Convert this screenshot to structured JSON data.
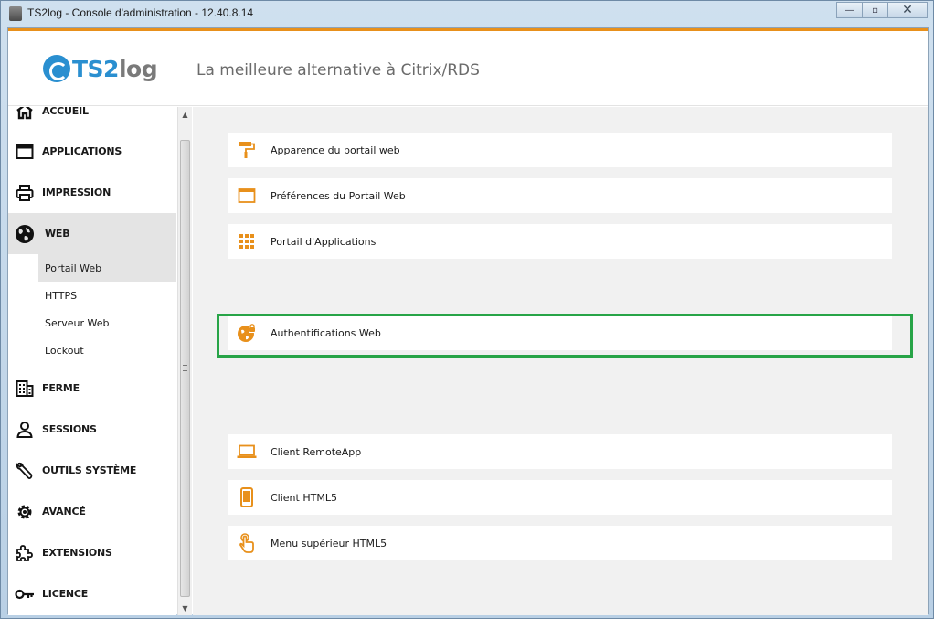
{
  "window": {
    "title": "TS2log - Console d'administration - 12.40.8.14",
    "minimize_glyph": "—",
    "maximize_glyph": "▫",
    "close_glyph": "✕"
  },
  "header": {
    "logo_ts": "TS2",
    "logo_log": "log",
    "tagline": "La meilleure alternative à Citrix/RDS"
  },
  "colors": {
    "accent": "#e8901b",
    "brand_blue": "#2a8fd0",
    "highlight": "#27a447"
  },
  "sidebar": {
    "items": [
      {
        "label": "ACCUEIL",
        "icon": "home-icon"
      },
      {
        "label": "APPLICATIONS",
        "icon": "window-icon"
      },
      {
        "label": "IMPRESSION",
        "icon": "printer-icon"
      },
      {
        "label": "WEB",
        "icon": "globe-icon",
        "active": true
      },
      {
        "label": "FERME",
        "icon": "building-icon"
      },
      {
        "label": "SESSIONS",
        "icon": "user-icon"
      },
      {
        "label": "OUTILS SYSTÈME",
        "icon": "wrench-icon"
      },
      {
        "label": "AVANCÉ",
        "icon": "gear-icon"
      },
      {
        "label": "EXTENSIONS",
        "icon": "puzzle-icon"
      },
      {
        "label": "LICENCE",
        "icon": "key-icon"
      }
    ],
    "web_subitems": [
      {
        "label": "Portail Web",
        "active": true
      },
      {
        "label": "HTTPS"
      },
      {
        "label": "Serveur Web"
      },
      {
        "label": "Lockout"
      }
    ]
  },
  "main": {
    "cards": [
      {
        "label": "Apparence du portail web",
        "icon": "paint-roller-icon"
      },
      {
        "label": "Préférences du Portail Web",
        "icon": "browser-window-icon"
      },
      {
        "label": "Portail d'Applications",
        "icon": "app-grid-icon"
      },
      {
        "label": "Authentifications Web",
        "icon": "globe-lock-icon",
        "highlighted": true
      },
      {
        "label": "Client RemoteApp",
        "icon": "laptop-icon"
      },
      {
        "label": "Client HTML5",
        "icon": "smartphone-icon"
      },
      {
        "label": "Menu supérieur HTML5",
        "icon": "touch-hand-icon"
      }
    ]
  }
}
